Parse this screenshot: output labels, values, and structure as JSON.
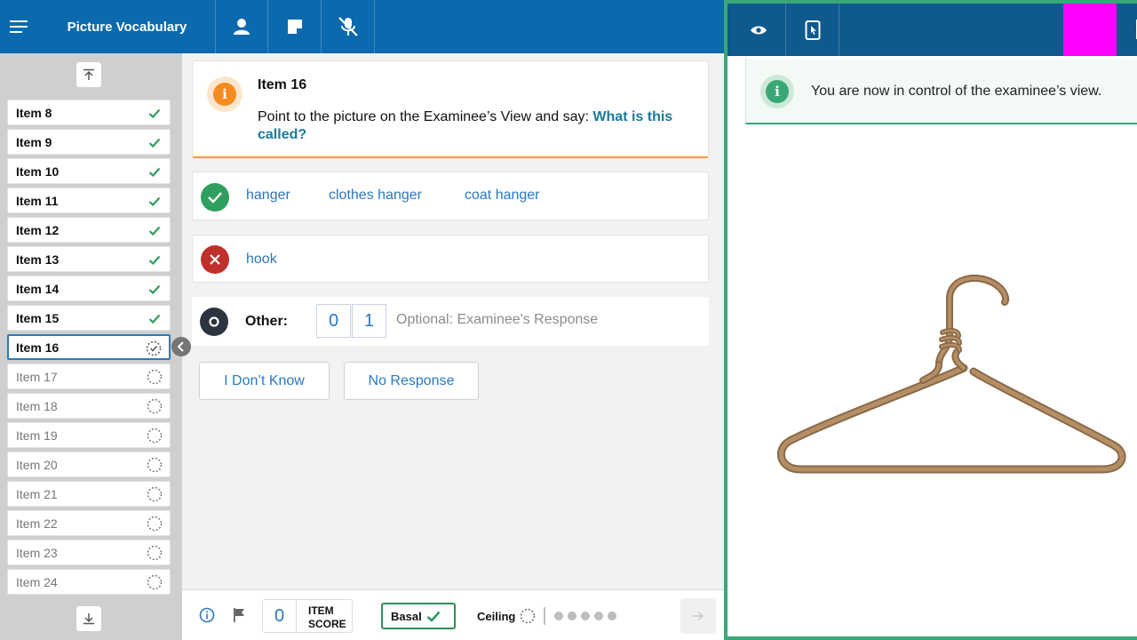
{
  "header": {
    "title": "Picture Vocabulary",
    "icons": [
      "menu-icon",
      "person-icon",
      "note-icon",
      "mic-off-icon"
    ]
  },
  "sidebar": {
    "items": [
      {
        "label": "Item 8",
        "state": "done"
      },
      {
        "label": "Item 9",
        "state": "done"
      },
      {
        "label": "Item 10",
        "state": "done"
      },
      {
        "label": "Item 11",
        "state": "done"
      },
      {
        "label": "Item 12",
        "state": "done"
      },
      {
        "label": "Item 13",
        "state": "done"
      },
      {
        "label": "Item 14",
        "state": "done"
      },
      {
        "label": "Item 15",
        "state": "done"
      },
      {
        "label": "Item 16",
        "state": "current"
      },
      {
        "label": "Item 17",
        "state": "pending"
      },
      {
        "label": "Item 18",
        "state": "pending"
      },
      {
        "label": "Item 19",
        "state": "pending"
      },
      {
        "label": "Item 20",
        "state": "pending"
      },
      {
        "label": "Item 21",
        "state": "pending"
      },
      {
        "label": "Item 22",
        "state": "pending"
      },
      {
        "label": "Item 23",
        "state": "pending"
      },
      {
        "label": "Item 24",
        "state": "pending"
      }
    ]
  },
  "prompt": {
    "title": "Item 16",
    "instruction": "Point to the picture on the Examinee’s View and say: ",
    "emphasis": "What is this called?"
  },
  "responses": {
    "correct": [
      "hanger",
      "clothes hanger",
      "coat hanger"
    ],
    "incorrect": [
      "hook"
    ],
    "other_label": "Other:",
    "score_options": [
      "0",
      "1"
    ],
    "other_placeholder": "Optional: Examinee's Response"
  },
  "buttons": {
    "dont_know": "I Don’t Know",
    "no_response": "No Response"
  },
  "footer": {
    "item_score": "0",
    "item_score_label_line1": "ITEM",
    "item_score_label_line2": "SCORE",
    "basal_label": "Basal",
    "ceiling_label": "Ceiling",
    "ceiling_dots": 5
  },
  "examinee_view": {
    "toast_text": "You are now in control of the examinee’s view.",
    "stimulus": "coat-hanger-image",
    "icons": [
      "eye-icon",
      "tablet-pointer-icon"
    ]
  },
  "colors": {
    "brand_blue": "#0a6aad",
    "right_bar": "#0e5a8e",
    "accent_orange": "#f58a1f",
    "success_green": "#2f9e5f",
    "error_red": "#c0302b",
    "frame_green": "#3aa876",
    "link_blue": "#2a78bf"
  }
}
